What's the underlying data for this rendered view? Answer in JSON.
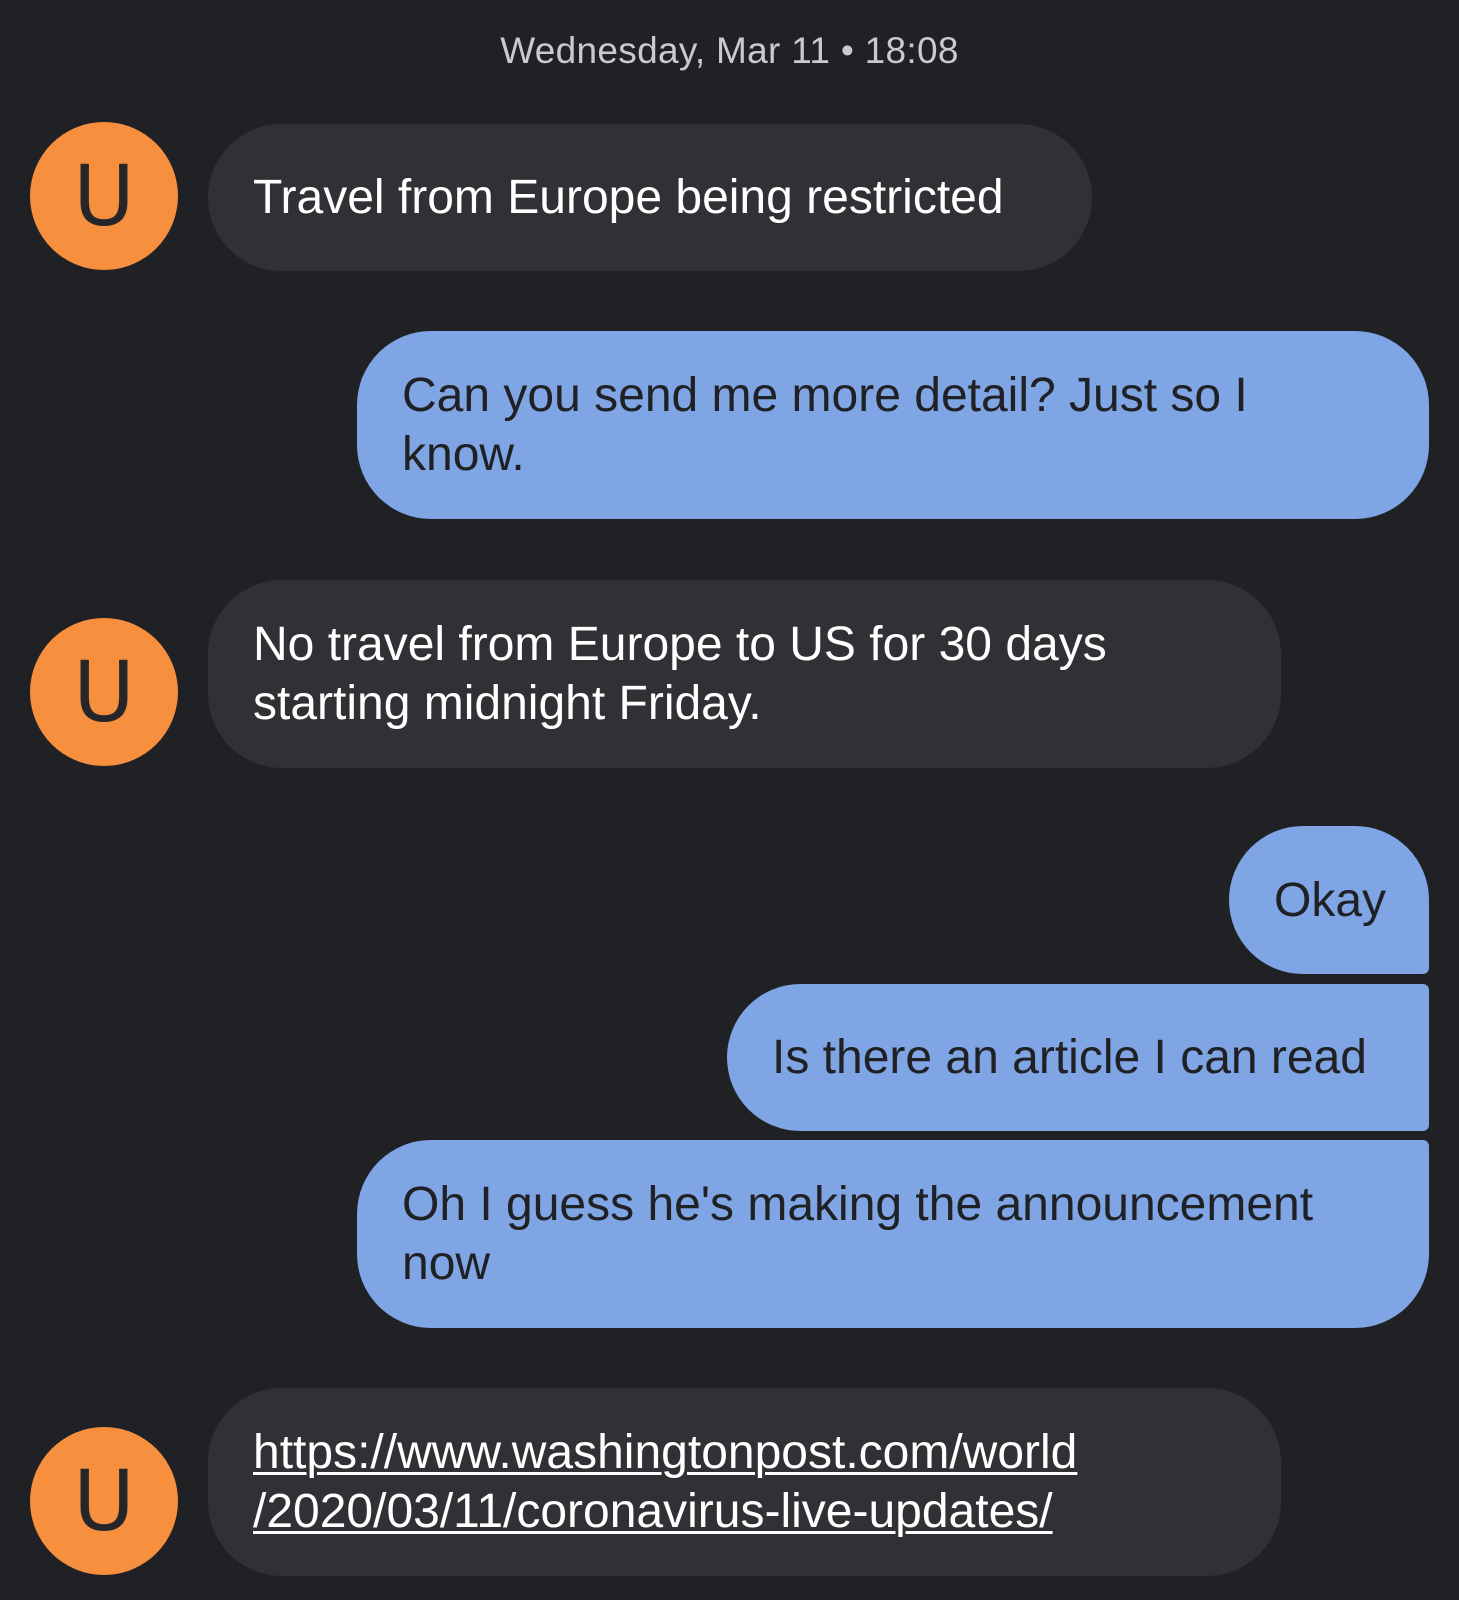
{
  "conversation": {
    "timestamp": "Wednesday, Mar 11 • 18:08",
    "avatar_letter": "U",
    "avatar_color": "#f6903e",
    "incoming_color": "#303134",
    "outgoing_color": "#7fa5e5",
    "messages": [
      {
        "from": "contact",
        "text": "Travel from Europe being restricted"
      },
      {
        "from": "me",
        "line1": "Can you send me more detail? Just so I",
        "line2": "know."
      },
      {
        "from": "contact",
        "line1": "No travel from Europe to US for 30 days",
        "line2": "starting midnight Friday."
      },
      {
        "from": "me",
        "text": "Okay"
      },
      {
        "from": "me",
        "text": "Is there an article I can read"
      },
      {
        "from": "me",
        "line1": "Oh I guess he's making the announcement",
        "line2": "now"
      },
      {
        "from": "contact",
        "line1": "https://www.washingtonpost.com/world",
        "line2": "/2020/03/11/coronavirus-live-updates/"
      }
    ]
  }
}
